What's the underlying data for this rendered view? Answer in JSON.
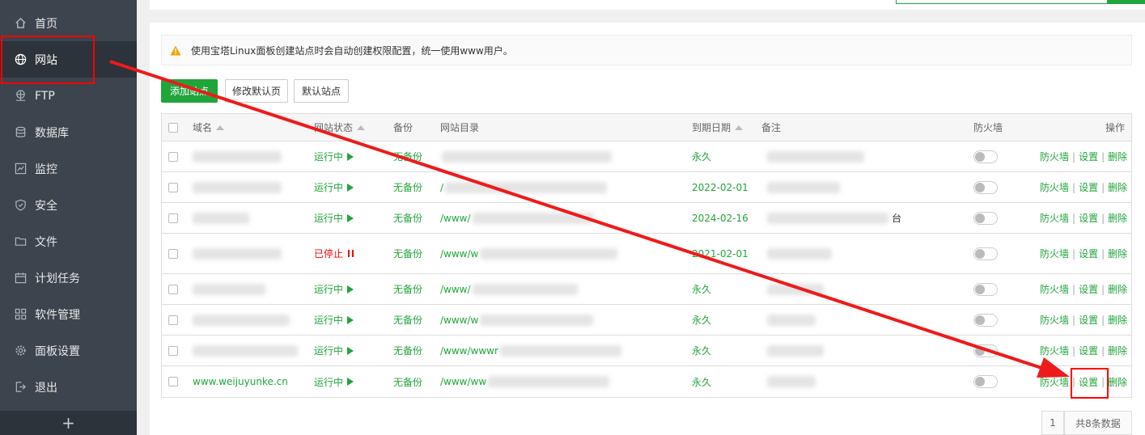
{
  "sidebar": {
    "items": [
      {
        "label": "首页",
        "icon": "home-icon"
      },
      {
        "label": "网站",
        "icon": "globe-icon"
      },
      {
        "label": "FTP",
        "icon": "ftp-icon"
      },
      {
        "label": "数据库",
        "icon": "database-icon"
      },
      {
        "label": "监控",
        "icon": "monitor-icon"
      },
      {
        "label": "安全",
        "icon": "shield-icon"
      },
      {
        "label": "文件",
        "icon": "folder-icon"
      },
      {
        "label": "计划任务",
        "icon": "calendar-icon"
      },
      {
        "label": "软件管理",
        "icon": "apps-icon"
      },
      {
        "label": "面板设置",
        "icon": "gear-icon"
      },
      {
        "label": "退出",
        "icon": "logout-icon"
      }
    ],
    "active_index": 1,
    "add_label": "+"
  },
  "notice": {
    "text": "使用宝塔Linux面板创建站点时会自动创建权限配置，统一使用www用户。"
  },
  "toolbar": {
    "add_site": "添加站点",
    "edit_default_page": "修改默认页",
    "default_site": "默认站点"
  },
  "table": {
    "headers": {
      "domain": "域名",
      "status": "网站状态",
      "backup": "备份",
      "root": "网站目录",
      "expire": "到期日期",
      "note": "备注",
      "firewall": "防火墙",
      "ops": "操作"
    },
    "rows": [
      {
        "domain": "",
        "status": "运行中",
        "running": true,
        "backup": "无备份",
        "root": "",
        "expire": "永久",
        "note": ""
      },
      {
        "domain": "",
        "status": "运行中",
        "running": true,
        "backup": "无备份",
        "root": "/",
        "expire": "2022-02-01",
        "note": ""
      },
      {
        "domain": "",
        "status": "运行中",
        "running": true,
        "backup": "无备份",
        "root": "/www/",
        "expire": "2024-02-16",
        "note": "台"
      },
      {
        "domain": "",
        "status": "已停止",
        "running": false,
        "backup": "无备份",
        "root": "/www/w",
        "expire": "2021-02-01",
        "note": ""
      },
      {
        "domain": "",
        "status": "运行中",
        "running": true,
        "backup": "无备份",
        "root": "/www/",
        "expire": "永久",
        "note": ""
      },
      {
        "domain": "",
        "status": "运行中",
        "running": true,
        "backup": "无备份",
        "root": "/www/w",
        "expire": "永久",
        "note": ""
      },
      {
        "domain": "",
        "status": "运行中",
        "running": true,
        "backup": "无备份",
        "root": "/www/wwwr",
        "expire": "永久",
        "note": ""
      },
      {
        "domain": "www.weijuyunke.cn",
        "status": "运行中",
        "running": true,
        "backup": "无备份",
        "root": "/www/ww",
        "expire": "永久",
        "note": ""
      }
    ],
    "ops": {
      "firewall": "防火墙",
      "settings": "设置",
      "delete": "删除",
      "sep": "|"
    }
  },
  "pagination": {
    "page": "1",
    "total": "共8条数据"
  },
  "colors": {
    "accent": "#20a53a",
    "stopped": "#ef0808",
    "annotation": "#ff0000",
    "sidebar_bg": "#3c444d"
  }
}
